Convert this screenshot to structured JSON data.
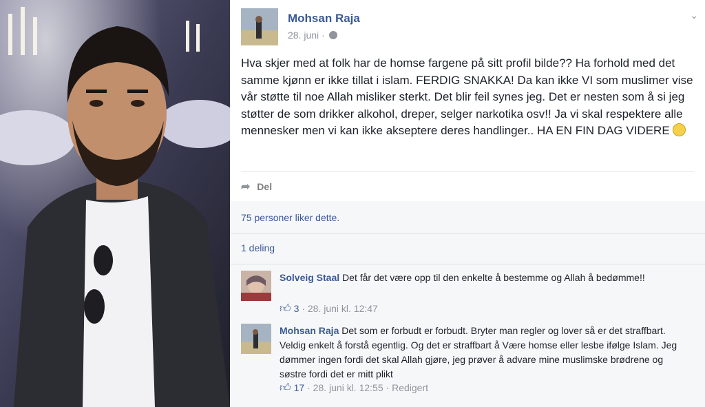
{
  "post": {
    "author": "Mohsan Raja",
    "date": "28. juni",
    "meta_sep": "·",
    "text_before": "Hva skjer med at folk har de homse fargene på sitt profil bilde?? Ha forhold med det samme kjønn er ikke tillat i islam. FERDIG SNAKKA! Da kan ikke VI som muslimer vise vår støtte til noe Allah misliker sterkt. Det blir feil synes jeg. Det er nesten som å si jeg støtter de som drikker alkohol, dreper, selger narkotika osv!! Ja vi skal respektere alle mennesker men vi kan ikke akseptere deres handlinger.. HA EN FIN DAG VIDERE",
    "share_label": "Del",
    "likes_text": "75 personer liker dette.",
    "shares_text": "1 deling"
  },
  "icons": {
    "globe": "globe-icon",
    "chevron": "chevron-down-icon",
    "share": "share-arrow-icon",
    "like": "thumbs-up-icon",
    "smiley": "smiley-emoji-icon"
  },
  "colors": {
    "link": "#3b5998",
    "meta": "#90949c",
    "text": "#1d2129",
    "ufi_bg": "#f6f7f9"
  },
  "comments": [
    {
      "name": "Solveig Staal",
      "text": "Det får det være opp til den enkelte å bestemme og Allah å bedømme!!",
      "likes": "3",
      "sep": "·",
      "time": "28. juni kl. 12:47",
      "edited": ""
    },
    {
      "name": "Mohsan Raja",
      "text": "Det som er forbudt er forbudt. Bryter man regler og lover så er det straffbart. Veldig enkelt å forstå egentlig. Og det er straffbart å Være homse eller lesbe ifølge Islam. Jeg dømmer ingen fordi det skal Allah gjøre, jeg prøver å advare mine muslimske brødrene og søstre fordi det er mitt plikt",
      "likes": "17",
      "sep": "·",
      "time": "28. juni kl. 12:55",
      "sep2": "·",
      "edited": "Redigert"
    }
  ]
}
